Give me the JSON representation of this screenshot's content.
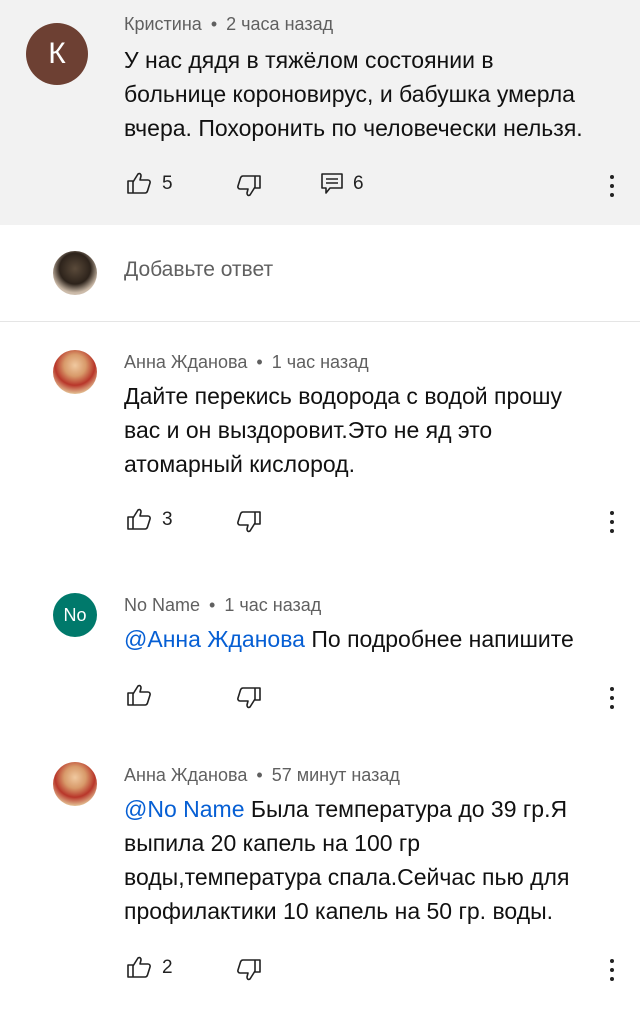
{
  "comments": [
    {
      "author": "Кристина",
      "time": "2 часа назад",
      "avatar_letter": "К",
      "avatar_color": "#6d4033",
      "lines": [
        "У нас дядя в тяжёлом состоянии в",
        "больнице короновирус, и бабушка умерла",
        "вчера. Похоронить по человечески нельзя."
      ],
      "likes": "5",
      "replies": "6"
    },
    {
      "author": "Анна Жданова",
      "time": "1 час назад",
      "lines": [
        "Дайте перекись водорода с водой прошу",
        "вас и он выздоровит.Это не яд это",
        "атомарный кислород."
      ],
      "likes": "3"
    },
    {
      "author": "No Name",
      "time": "1 час назад",
      "avatar_letter": "No",
      "avatar_color": "#00796b",
      "mention": "@Анна Жданова",
      "text": " По подробнее напишите"
    },
    {
      "author": "Анна Жданова",
      "time": "57 минут назад",
      "mention": "@No Name",
      "text": " Была температура до 39 гр.Я",
      "lines": [
        "выпила 20 капель на 100 гр",
        "воды,температура спала.Сейчас пью для",
        "профилактики 10 капель на 50 гр. воды."
      ],
      "likes": "2"
    }
  ],
  "add_reply": {
    "placeholder": "Добавьте ответ"
  },
  "separator": "•",
  "icons": [
    "like-icon",
    "dislike-icon",
    "reply-icon",
    "more-icon"
  ]
}
